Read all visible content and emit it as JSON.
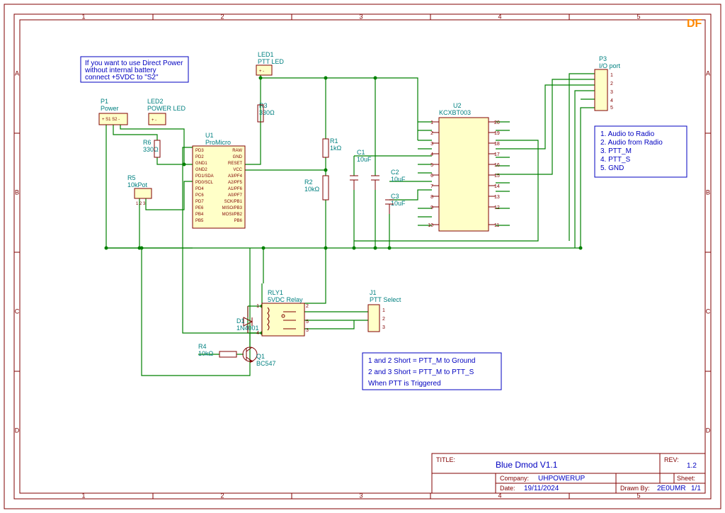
{
  "logo": "DF",
  "titleblock": {
    "title_label": "TITLE:",
    "title": "Blue Dmod V1.1",
    "rev_label": "REV:",
    "rev": "1.2",
    "company_label": "Company:",
    "company": "UHPOWERUP",
    "sheet_label": "Sheet:",
    "sheet": "1/1",
    "date_label": "Date:",
    "date": "19/11/2024",
    "drawn_label": "Drawn By:",
    "drawn": "2E0UMR"
  },
  "notes": {
    "power_note_l1": "If you want to use Direct Power",
    "power_note_l2": "without internal battery",
    "power_note_l3": "connect +5VDC to \"S2\"",
    "io_l1": "1. Audio to Radio",
    "io_l2": "2. Audio from Radio",
    "io_l3": "3. PTT_M",
    "io_l4": "4. PTT_S",
    "io_l5": "5. GND",
    "ptt_l1": "1 and 2 Short = PTT_M to Ground",
    "ptt_l2": "2 and 3 Short = PTT_M to PTT_S",
    "ptt_l3": "When PTT is Triggered"
  },
  "components": {
    "U1": {
      "ref": "U1",
      "val": "ProMicro",
      "left": [
        "PD3",
        "PD2",
        "GND1",
        "GND2",
        "PD1/SDA",
        "PD0/SCL",
        "PD4",
        "PC6",
        "PD7",
        "PE6",
        "PB4",
        "PB5"
      ],
      "right": [
        "RAW",
        "GND",
        "RESET",
        "VCC",
        "A3/PF4",
        "A2/PF5",
        "A1/PF6",
        "A0/PF7",
        "SCK/PB1",
        "MISO/PB3",
        "MOSI/PB2",
        "PB6"
      ]
    },
    "U2": {
      "ref": "U2",
      "val": "KCXBT003"
    },
    "RLY1": {
      "ref": "RLY1",
      "val": "5VDC Relay"
    },
    "D1": {
      "ref": "D1",
      "val": "1N4001"
    },
    "Q1": {
      "ref": "Q1",
      "val": "BC547"
    },
    "R3": {
      "ref": "R3",
      "val": "330Ω"
    },
    "R6": {
      "ref": "R6",
      "val": "330Ω"
    },
    "R1": {
      "ref": "R1",
      "val": "1kΩ"
    },
    "R2": {
      "ref": "R2",
      "val": "10kΩ"
    },
    "R4": {
      "ref": "R4",
      "val": "10kΩ"
    },
    "R5": {
      "ref": "R5",
      "val": "10kPot"
    },
    "C1": {
      "ref": "C1",
      "val": "10uF"
    },
    "C2": {
      "ref": "C2",
      "val": "10uF"
    },
    "C3": {
      "ref": "C3",
      "val": "10uF"
    },
    "LED1": {
      "ref": "LED1",
      "val": "PTT LED"
    },
    "LED2": {
      "ref": "LED2",
      "val": "POWER LED"
    },
    "P1": {
      "ref": "P1",
      "val": "Power"
    },
    "P3": {
      "ref": "P3",
      "val": "I/O port"
    },
    "J1": {
      "ref": "J1",
      "val": "PTT Select"
    }
  },
  "ruler": {
    "cols": [
      "1",
      "2",
      "3",
      "4",
      "5"
    ],
    "rows": [
      "A",
      "B",
      "C",
      "D"
    ]
  }
}
